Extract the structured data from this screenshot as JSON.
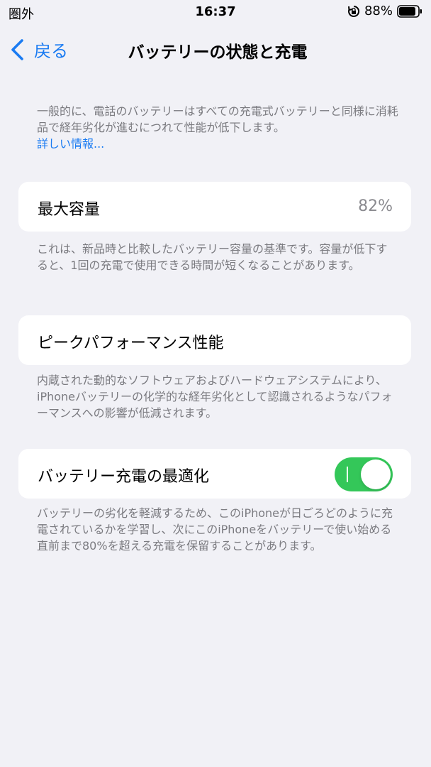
{
  "status_bar": {
    "carrier": "圏外",
    "time": "16:37",
    "battery_percent": "88%",
    "battery_level": 0.88
  },
  "nav": {
    "back_label": "戻る",
    "title": "バッテリーの状態と充電"
  },
  "intro": {
    "text": "一般的に、電話のバッテリーはすべての充電式バッテリーと同様に消耗品で経年劣化が進むにつれて性能が低下します。",
    "link": "詳しい情報..."
  },
  "max_capacity": {
    "label": "最大容量",
    "value": "82%",
    "footnote": "これは、新品時と比較したバッテリー容量の基準です。容量が低下すると、1回の充電で使用できる時間が短くなることがあります。"
  },
  "peak_performance": {
    "label": "ピークパフォーマンス性能",
    "footnote": "内蔵された動的なソフトウェアおよびハードウェアシステムにより、iPhoneバッテリーの化学的な経年劣化として認識されるようなパフォーマンスへの影響が低減されます。"
  },
  "optimized_charging": {
    "label": "バッテリー充電の最適化",
    "enabled": true,
    "footnote": "バッテリーの劣化を軽減するため、このiPhoneが日ごろどのように充電されているかを学習し、次にこのiPhoneをバッテリーで使い始める直前まで80%を超える充電を保留することがあります。"
  },
  "colors": {
    "accent": "#1a7bf2",
    "toggle_on": "#34c759",
    "background": "#f1f1f6"
  }
}
